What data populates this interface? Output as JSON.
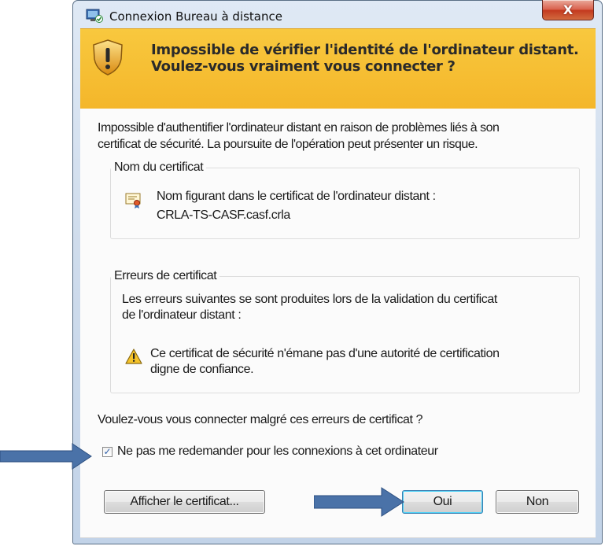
{
  "window": {
    "title": "Connexion Bureau à distance",
    "close_symbol": "X"
  },
  "banner": {
    "line1": "Impossible de vérifier l'identité de l'ordinateur distant.",
    "line2": "Voulez-vous vraiment vous connecter ?",
    "icon": "shield-warning-icon"
  },
  "intro": {
    "line1": "Impossible d'authentifier l'ordinateur distant en raison de problèmes liés à son",
    "line2": "certificat de sécurité. La poursuite de l'opération peut présenter un risque."
  },
  "cert_name_group": {
    "legend": "Nom du certificat",
    "label": "Nom figurant dans le certificat de l'ordinateur distant :",
    "value": "CRLA-TS-CASF.casf.crla",
    "icon": "certificate-icon"
  },
  "cert_errors_group": {
    "legend": "Erreurs de certificat",
    "intro_line1": "Les erreurs suivantes se sont produites lors de la validation du certificat",
    "intro_line2": "de l'ordinateur distant :",
    "error_line1": "Ce certificat de sécurité n'émane pas d'une autorité de certification",
    "error_line2": "digne de confiance.",
    "icon": "warning-icon"
  },
  "question": "Voulez-vous vous connecter malgré ces erreurs de certificat ?",
  "checkbox": {
    "label": "Ne pas me redemander pour les connexions à cet ordinateur",
    "checked": true,
    "mark": "✓"
  },
  "buttons": {
    "view_certificate": "Afficher le certificat...",
    "yes": "Oui",
    "no": "Non"
  },
  "colors": {
    "banner": "#f6be34",
    "arrow": "#4a72a8",
    "close": "#c3391f"
  }
}
